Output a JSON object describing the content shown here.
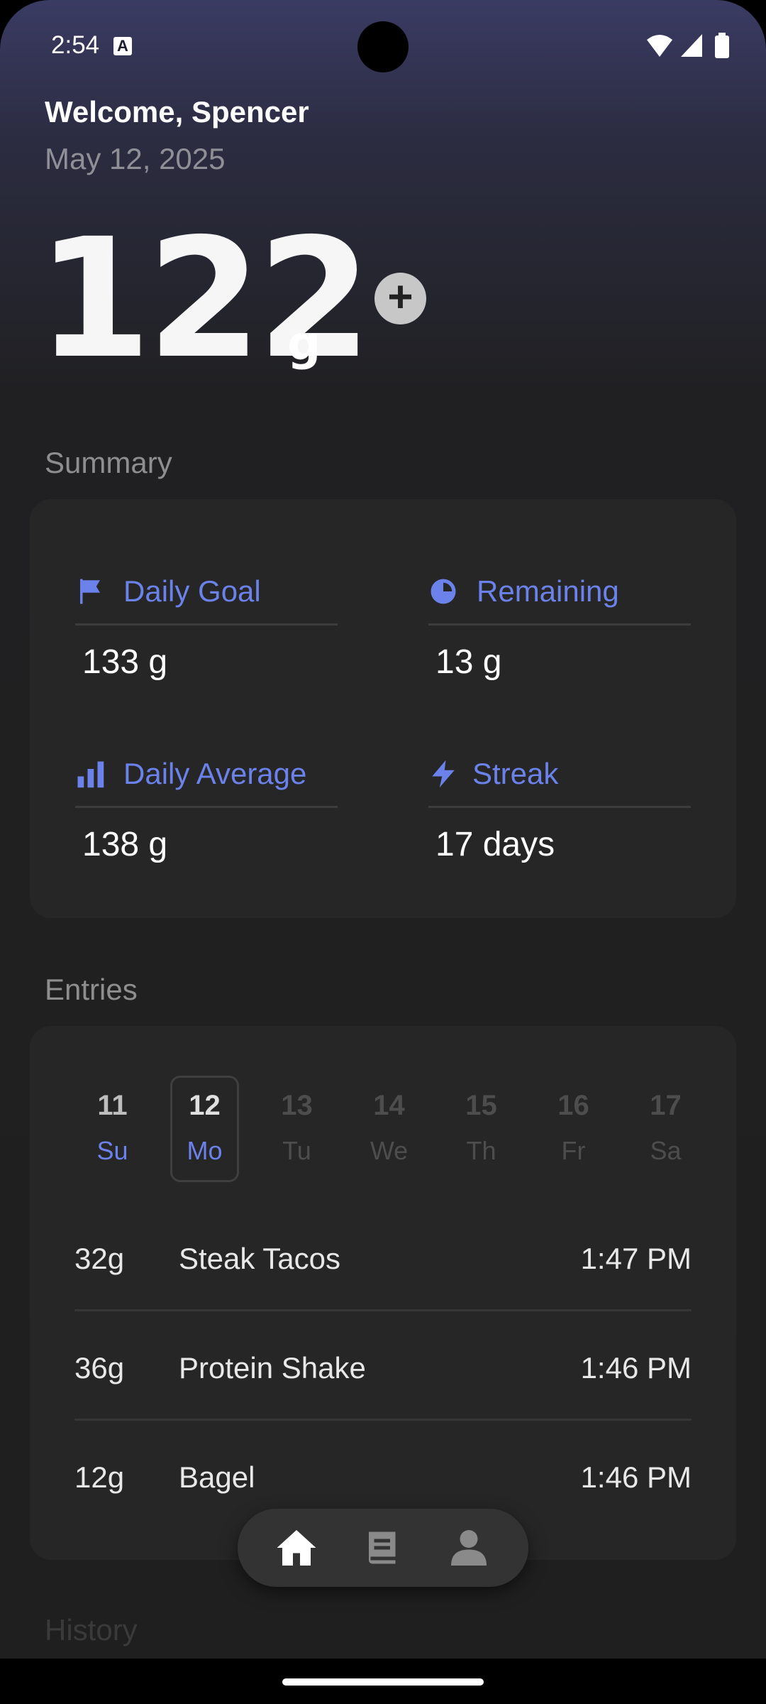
{
  "status_bar": {
    "time": "2:54"
  },
  "header": {
    "welcome": "Welcome, Spencer",
    "date": "May 12, 2025"
  },
  "total": {
    "value": "122",
    "unit": "g"
  },
  "summary": {
    "label": "Summary",
    "stats": [
      {
        "icon": "flag-icon",
        "label": "Daily Goal",
        "value": "133 g"
      },
      {
        "icon": "pie-chart-icon",
        "label": "Remaining",
        "value": "13 g"
      },
      {
        "icon": "bar-chart-icon",
        "label": "Daily Average",
        "value": "138 g"
      },
      {
        "icon": "lightning-icon",
        "label": "Streak",
        "value": "17 days"
      }
    ]
  },
  "entries": {
    "label": "Entries",
    "days": [
      {
        "num": "11",
        "dow": "Su"
      },
      {
        "num": "12",
        "dow": "Mo"
      },
      {
        "num": "13",
        "dow": "Tu"
      },
      {
        "num": "14",
        "dow": "We"
      },
      {
        "num": "15",
        "dow": "Th"
      },
      {
        "num": "16",
        "dow": "Fr"
      },
      {
        "num": "17",
        "dow": "Sa"
      }
    ],
    "items": [
      {
        "grams": "32g",
        "food": "Steak Tacos",
        "time": "1:47 PM"
      },
      {
        "grams": "36g",
        "food": "Protein Shake",
        "time": "1:46 PM"
      },
      {
        "grams": "12g",
        "food": "Bagel",
        "time": "1:46 PM"
      }
    ]
  },
  "history": {
    "label": "History"
  },
  "colors": {
    "accent": "#6b82ea",
    "card": "#262626"
  }
}
